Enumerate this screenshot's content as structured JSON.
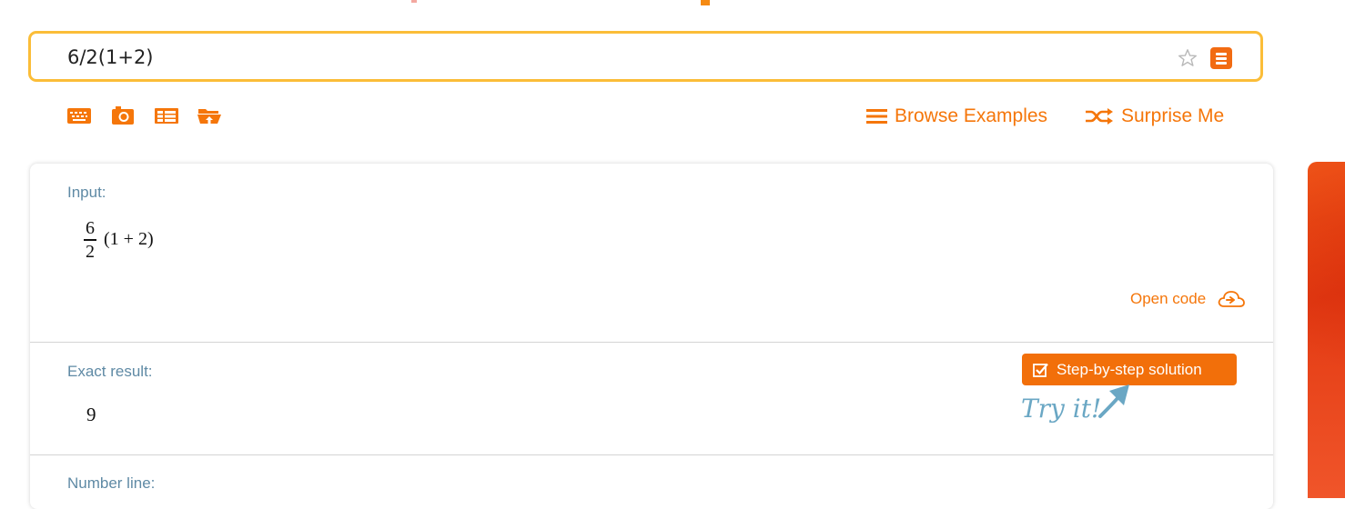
{
  "search": {
    "query": "6/2(1+2)",
    "star_icon": "star-outline-icon",
    "logo_icon": "wolfram-alpha-logo-icon"
  },
  "toolbar": {
    "icons": [
      "keyboard-icon",
      "camera-icon",
      "table-icon",
      "folder-upload-icon"
    ],
    "browse_examples": "Browse Examples",
    "surprise_me": "Surprise Me"
  },
  "pods": {
    "input": {
      "title": "Input:",
      "numerator": "6",
      "denominator": "2",
      "parenthetical": "(1 + 2)",
      "open_code": "Open code"
    },
    "exact_result": {
      "title": "Exact result:",
      "value": "9",
      "step_button": "Step-by-step solution",
      "try_it": "Try it!"
    },
    "number_line": {
      "title": "Number line:"
    }
  },
  "colors": {
    "accent": "#f5760a",
    "search_border": "#fbbd38",
    "pod_title": "#5f8aa5",
    "try_it": "#6aa7c4"
  }
}
